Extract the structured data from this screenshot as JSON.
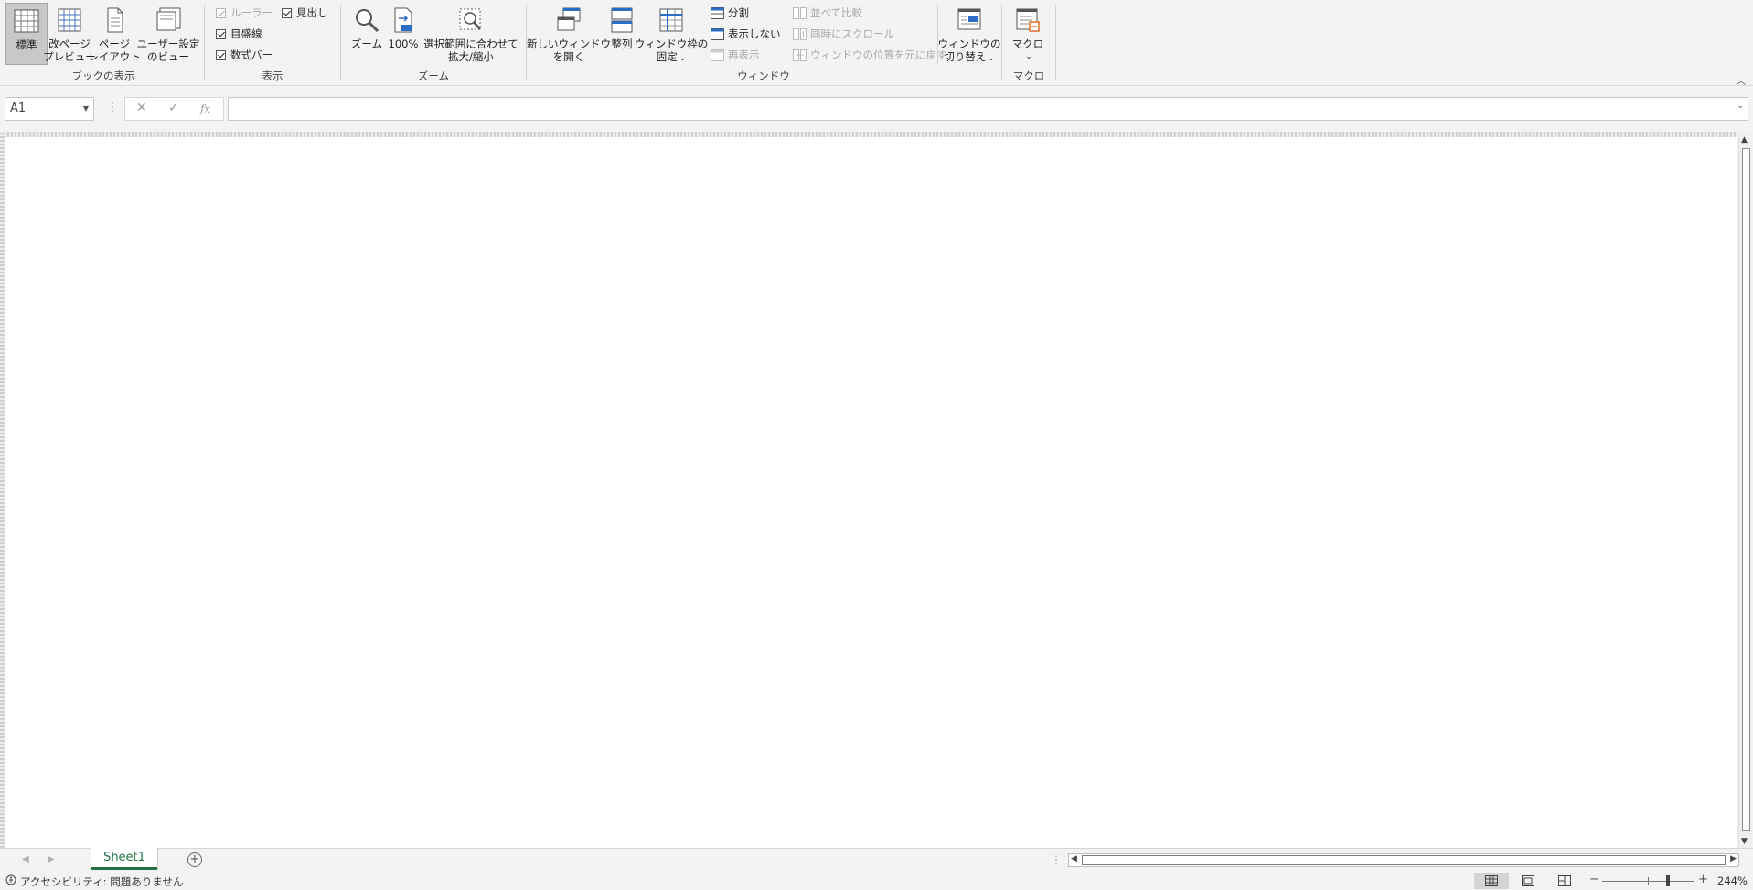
{
  "ribbon": {
    "book_view": {
      "group_label": "ブックの表示",
      "normal": [
        "標準"
      ],
      "page_break": [
        "改ページ",
        "プレビュー"
      ],
      "page_layout": [
        "ページ",
        "レイアウト"
      ],
      "custom_views": [
        "ユーザー設定",
        "のビュー"
      ]
    },
    "show": {
      "group_label": "表示",
      "ruler": {
        "label": "ルーラー",
        "checked": true,
        "enabled": false
      },
      "gridlines": {
        "label": "目盛線",
        "checked": true,
        "enabled": true
      },
      "formula_bar": {
        "label": "数式バー",
        "checked": true,
        "enabled": true
      },
      "headings": {
        "label": "見出し",
        "checked": true,
        "enabled": true
      }
    },
    "zoom": {
      "group_label": "ズーム",
      "zoom": [
        "ズーム"
      ],
      "hundred": [
        "100%"
      ],
      "zoom_selection": [
        "選択範囲に合わせて",
        "拡大/縮小"
      ]
    },
    "window": {
      "group_label": "ウィンドウ",
      "new_window": [
        "新しいウィンドウ",
        "を開く"
      ],
      "arrange": [
        "整列"
      ],
      "freeze": [
        "ウィンドウ枠の",
        "固定"
      ],
      "split": "分割",
      "hide": "表示しない",
      "unhide": "再表示",
      "side_by_side": "並べて比較",
      "sync_scroll": "同時にスクロール",
      "reset_position": "ウィンドウの位置を元に戻す",
      "switch_windows": [
        "ウィンドウの",
        "切り替え"
      ]
    },
    "macros": {
      "group_label": "マクロ",
      "macros": [
        "マクロ"
      ]
    }
  },
  "formula_bar": {
    "name_box": "A1",
    "formula": "",
    "fx": "fx"
  },
  "sheets": {
    "tabs": [
      "Sheet1"
    ],
    "active": "Sheet1"
  },
  "status": {
    "accessibility": "アクセシビリティ: 問題ありません",
    "zoom_level": "244%",
    "zoom_fraction": 0.72
  },
  "colors": {
    "accent": "#217346",
    "ribbon_bg": "#f3f3f3"
  }
}
